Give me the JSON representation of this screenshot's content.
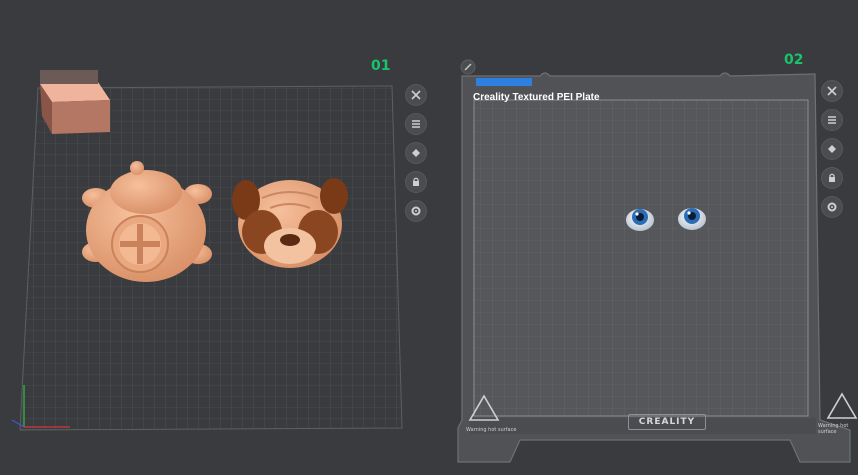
{
  "plates": [
    {
      "number": "01"
    },
    {
      "number": "02",
      "bed_name": "Creality Textured PEI Plate",
      "brand": "CREALITY",
      "warning_text": "Warning hot surface"
    }
  ],
  "plate_tools": [
    {
      "icon": "close-icon"
    },
    {
      "icon": "list-icon"
    },
    {
      "icon": "auto-arrange-icon"
    },
    {
      "icon": "lock-icon"
    },
    {
      "icon": "settings-gear-icon"
    }
  ],
  "objects": {
    "plate1": [
      "block-part",
      "pug-body-part",
      "pug-head-part"
    ],
    "plate2": [
      "eye-left",
      "eye-right"
    ]
  },
  "colors": {
    "background": "#3a3b3e",
    "plate_number": "#19c36b",
    "model_skin": "#e8a47e",
    "model_brown": "#7a3a17",
    "eye_iris": "#2a6db6"
  }
}
